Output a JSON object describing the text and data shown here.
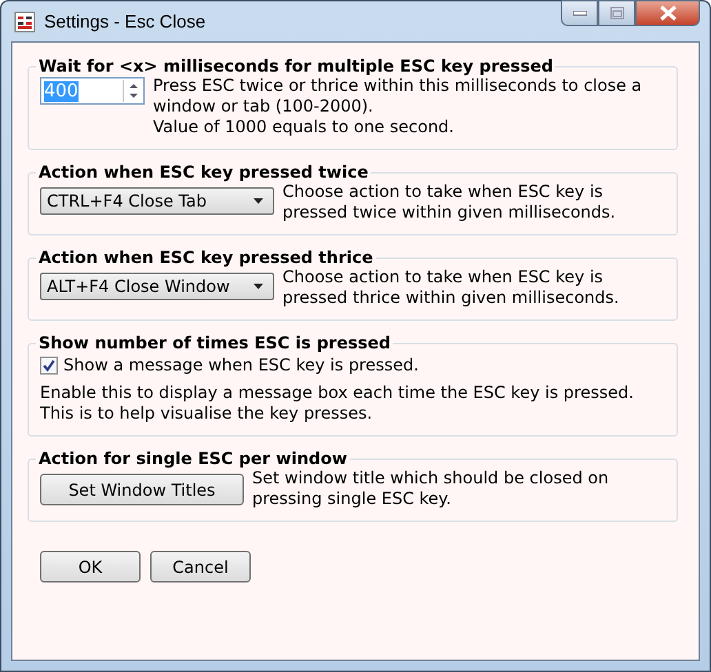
{
  "window": {
    "title": "Settings - Esc Close"
  },
  "groups": [
    {
      "kind": "spin",
      "title": "Wait for <x> milliseconds for multiple ESC key pressed",
      "value": "400",
      "lines": [
        "Press ESC twice or thrice within this milliseconds to close a window or tab  (100-2000).",
        "Value of 1000 equals to one second."
      ]
    },
    {
      "kind": "dropdown",
      "title": "Action when ESC key pressed twice",
      "value": "CTRL+F4 Close Tab",
      "lines": [
        "Choose action to take when ESC key is pressed twice within given milliseconds."
      ]
    },
    {
      "kind": "dropdown",
      "title": "Action when ESC key pressed thrice",
      "value": "ALT+F4 Close Window",
      "lines": [
        "Choose action to take when ESC key is pressed thrice within given milliseconds."
      ]
    },
    {
      "kind": "checkbox",
      "title": "Show number of times ESC is pressed",
      "label": "Show a message when ESC key is pressed.",
      "checked": true,
      "lines": [
        "Enable this to display a message box each time the ESC key is pressed. This is to help visualise the key presses."
      ]
    },
    {
      "kind": "button",
      "title": "Action for single ESC per window",
      "label": "Set Window Titles",
      "lines": [
        "Set window title which should be closed on pressing single ESC key."
      ]
    }
  ],
  "buttons": [
    "OK",
    "Cancel"
  ]
}
